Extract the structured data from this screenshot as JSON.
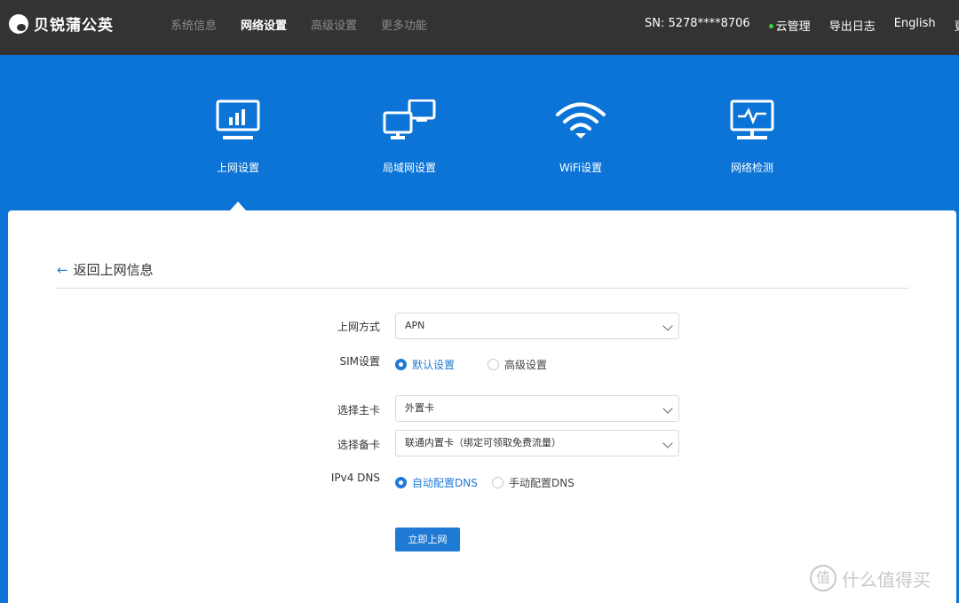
{
  "brand": {
    "logo_text": "贝锐蒲公英"
  },
  "nav": {
    "items": [
      "系统信息",
      "网络设置",
      "高级设置",
      "更多功能"
    ],
    "active_index": 1
  },
  "right_nav": {
    "sn": "SN:  5278****8706",
    "cloud": "云管理",
    "export_log": "导出日志",
    "language": "English",
    "more": "更多"
  },
  "tabs": [
    {
      "label": "上网设置",
      "icon": "monitor-chart-icon"
    },
    {
      "label": "局域网设置",
      "icon": "lan-monitors-icon"
    },
    {
      "label": "WiFi设置",
      "icon": "wifi-icon"
    },
    {
      "label": "网络检测",
      "icon": "monitor-pulse-icon"
    }
  ],
  "form": {
    "back_label": "返回上网信息",
    "mode_label": "上网方式",
    "mode_value": "APN",
    "sim_label": "SIM设置",
    "sim_default": "默认设置",
    "sim_advanced": "高级设置",
    "primary_label": "选择主卡",
    "primary_value": "外置卡",
    "backup_label": "选择备卡",
    "backup_value": "联通内置卡（绑定可领取免费流量）",
    "dns_label": "IPv4 DNS",
    "dns_auto": "自动配置DNS",
    "dns_manual": "手动配置DNS",
    "submit_label": "立即上网"
  },
  "watermark": {
    "text": "什么值得买",
    "badge": "值"
  },
  "colors": {
    "topbar": "#333333",
    "header_blue": "#0b74d6",
    "accent": "#1f7ad6",
    "cloud_dot": "#38d438"
  }
}
